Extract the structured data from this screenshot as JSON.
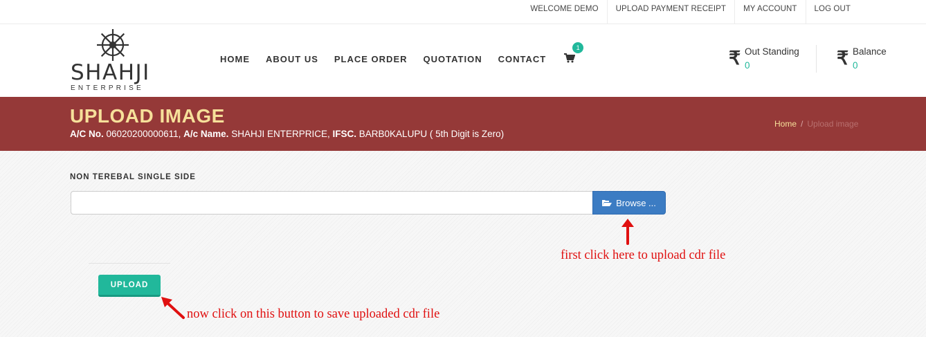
{
  "topbar": {
    "links": [
      "WELCOME DEMO",
      "UPLOAD PAYMENT RECEIPT",
      "MY ACCOUNT",
      "LOG OUT"
    ]
  },
  "logo": {
    "name": "SHAHJI",
    "sub": "ENTERPRISE"
  },
  "nav": {
    "items": [
      "HOME",
      "ABOUT US",
      "PLACE ORDER",
      "QUOTATION",
      "CONTACT"
    ],
    "cart_count": "1"
  },
  "account": {
    "outstanding_label": "Out Standing",
    "outstanding_value": "0",
    "balance_label": "Balance",
    "balance_value": "0",
    "currency_symbol": "₹"
  },
  "banner": {
    "title": "UPLOAD IMAGE",
    "ac_no_label": "A/C No.",
    "ac_no": "06020200000611,",
    "ac_name_label": "A/c Name.",
    "ac_name": "SHAHJI ENTERPRICE,",
    "ifsc_label": "IFSC.",
    "ifsc": "BARB0KALUPU ( 5th Digit is Zero)",
    "breadcrumb_home": "Home",
    "breadcrumb_sep": "/",
    "breadcrumb_current": "Upload image"
  },
  "form": {
    "field_label": "NON TEREBAL SINGLE SIDE",
    "file_value": "",
    "browse_label": "Browse ...",
    "upload_label": "UPLOAD"
  },
  "annotations": {
    "first": "first click here to upload cdr file",
    "second": "now click on this button to save uploaded cdr file"
  },
  "colors": {
    "banner": "#953938",
    "title": "#f6e09a",
    "accent": "#21b89b",
    "browse": "#3c7cc3",
    "annotation": "#e01010"
  }
}
